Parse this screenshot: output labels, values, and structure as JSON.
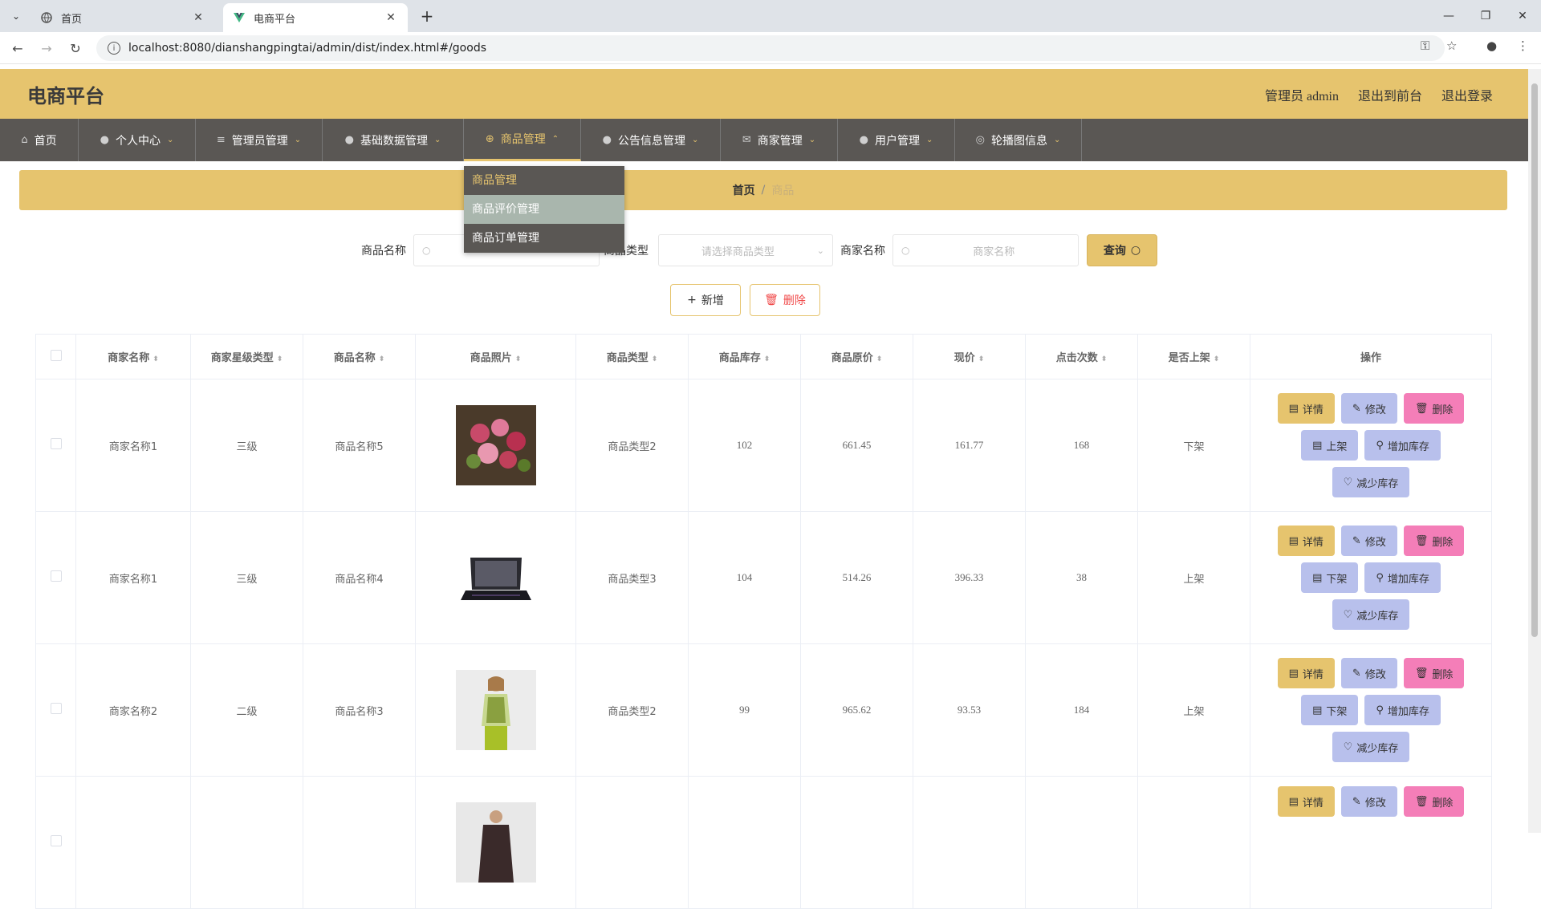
{
  "browser": {
    "tabs": [
      {
        "title": "首页",
        "icon": "globe-icon"
      },
      {
        "title": "电商平台",
        "icon": "vue-logo-icon"
      }
    ],
    "url": "localhost:8080/dianshangpingtai/admin/dist/index.html#/goods"
  },
  "header": {
    "brand": "电商平台",
    "admin_label": "管理员 admin",
    "exit_front": "退出到前台",
    "logout": "退出登录"
  },
  "nav": {
    "items": [
      {
        "label": "首页",
        "icon": "home-icon"
      },
      {
        "label": "个人中心",
        "icon": "user-icon"
      },
      {
        "label": "管理员管理",
        "icon": "list-icon"
      },
      {
        "label": "基础数据管理",
        "icon": "pin-icon"
      },
      {
        "label": "商品管理",
        "icon": "target-icon"
      },
      {
        "label": "公告信息管理",
        "icon": "user-icon"
      },
      {
        "label": "商家管理",
        "icon": "mail-icon"
      },
      {
        "label": "用户管理",
        "icon": "user-icon"
      },
      {
        "label": "轮播图信息",
        "icon": "compass-icon"
      }
    ],
    "dropdown": [
      "商品管理",
      "商品评价管理",
      "商品订单管理"
    ]
  },
  "breadcrumb": {
    "home": "首页",
    "sep": "/",
    "current": "商品"
  },
  "search": {
    "goods_name_label": "商品名称",
    "goods_type_label": "商品类型",
    "goods_type_placeholder": "请选择商品类型",
    "merchant_name_label": "商家名称",
    "merchant_name_placeholder": "商家名称",
    "query_label": "查询"
  },
  "actions": {
    "add_label": "新增",
    "delete_label": "删除"
  },
  "table": {
    "headers": [
      "商家名称",
      "商家星级类型",
      "商品名称",
      "商品照片",
      "商品类型",
      "商品库存",
      "商品原价",
      "现价",
      "点击次数",
      "是否上架",
      "操作"
    ],
    "rows": [
      {
        "merchant": "商家名称1",
        "star": "三级",
        "goods": "商品名称5",
        "photo": "flowers",
        "type": "商品类型2",
        "stock": "102",
        "price": "661.45",
        "now": "161.77",
        "clicks": "168",
        "shelf": "下架",
        "toggle": "上架"
      },
      {
        "merchant": "商家名称1",
        "star": "三级",
        "goods": "商品名称4",
        "photo": "laptop",
        "type": "商品类型3",
        "stock": "104",
        "price": "514.26",
        "now": "396.33",
        "clicks": "38",
        "shelf": "上架",
        "toggle": "下架"
      },
      {
        "merchant": "商家名称2",
        "star": "二级",
        "goods": "商品名称3",
        "photo": "model",
        "type": "商品类型2",
        "stock": "99",
        "price": "965.62",
        "now": "93.53",
        "clicks": "184",
        "shelf": "上架",
        "toggle": "下架"
      },
      {
        "merchant": "",
        "star": "",
        "goods": "",
        "photo": "coat",
        "type": "",
        "stock": "",
        "price": "",
        "now": "",
        "clicks": "",
        "shelf": "",
        "toggle": ""
      }
    ],
    "op_labels": {
      "detail": "详情",
      "edit": "修改",
      "delete": "删除",
      "add_stock": "增加库存",
      "reduce_stock": "减少库存"
    }
  },
  "colors": {
    "accent": "#e6c46e",
    "nav_bg": "#5a5754",
    "edit_btn": "#b8c0ec",
    "delete_btn": "#f47eb8"
  }
}
